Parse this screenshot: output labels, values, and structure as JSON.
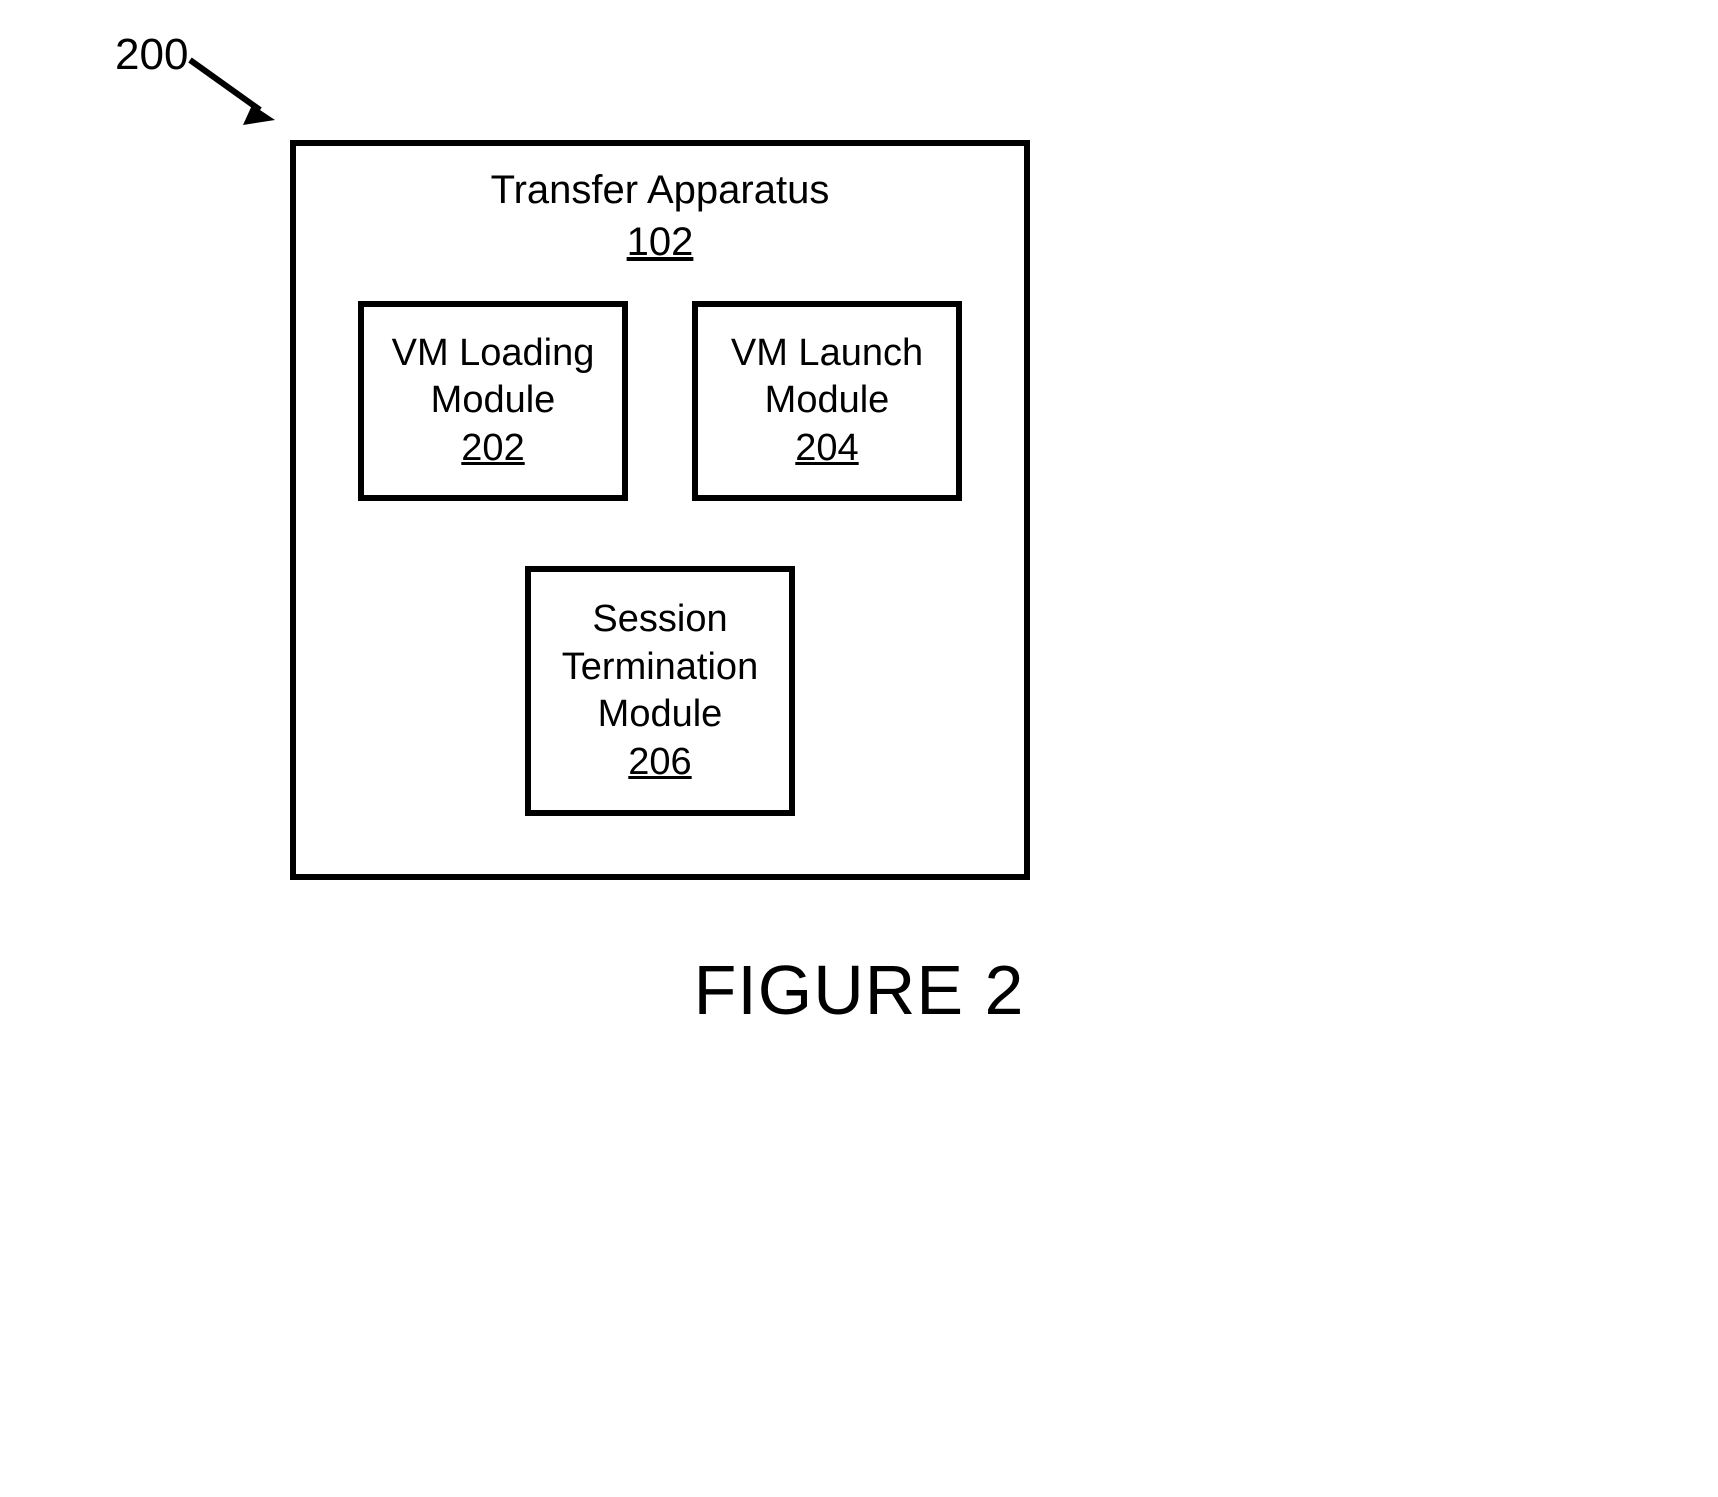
{
  "ref": "200",
  "outer": {
    "title": "Transfer Apparatus",
    "num": "102"
  },
  "modules": {
    "loading": {
      "line1": "VM Loading",
      "line2": "Module",
      "num": "202"
    },
    "launch": {
      "line1": "VM Launch",
      "line2": "Module",
      "num": "204"
    },
    "session": {
      "line1": "Session",
      "line2": "Termination",
      "line3": "Module",
      "num": "206"
    }
  },
  "caption": "FIGURE 2"
}
